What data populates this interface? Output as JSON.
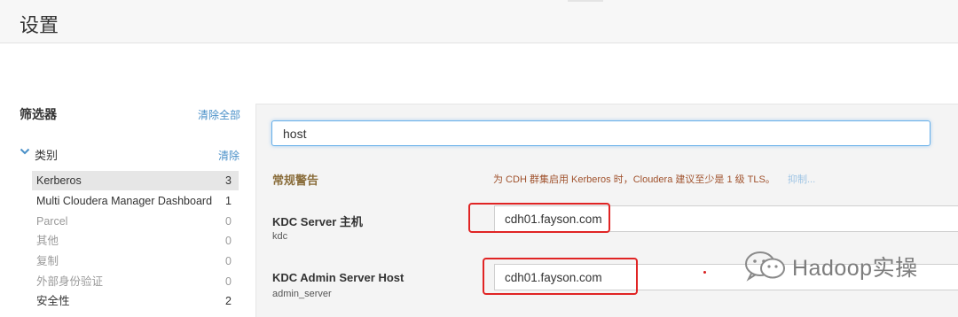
{
  "header": {
    "title": "设置"
  },
  "sidebar": {
    "filters_title": "筛选器",
    "clear_all": "清除全部",
    "category": {
      "label": "类别",
      "clear": "清除"
    },
    "items": [
      {
        "label": "Kerberos",
        "count": "3"
      },
      {
        "label": "Multi Cloudera Manager Dashboard",
        "count": "1"
      },
      {
        "label": "Parcel",
        "count": "0"
      },
      {
        "label": "其他",
        "count": "0"
      },
      {
        "label": "复制",
        "count": "0"
      },
      {
        "label": "外部身份验证",
        "count": "0"
      },
      {
        "label": "安全性",
        "count": "2"
      }
    ]
  },
  "search": {
    "value": "host"
  },
  "warning": {
    "title": "常规警告",
    "text": "为 CDH 群集启用 Kerberos 时，Cloudera 建议至少是 1 级 TLS。",
    "suppress": "抑制..."
  },
  "fields": [
    {
      "label": "KDC Server 主机",
      "key": "kdc",
      "value": "cdh01.fayson.com"
    },
    {
      "label": "KDC Admin Server Host",
      "key": "admin_server",
      "value": "cdh01.fayson.com"
    }
  ],
  "watermark": {
    "text": "Hadoop实操"
  },
  "colors": {
    "link": "#4a90c8",
    "highlight_border": "#e02424",
    "warning_title": "#8a6d3b"
  }
}
